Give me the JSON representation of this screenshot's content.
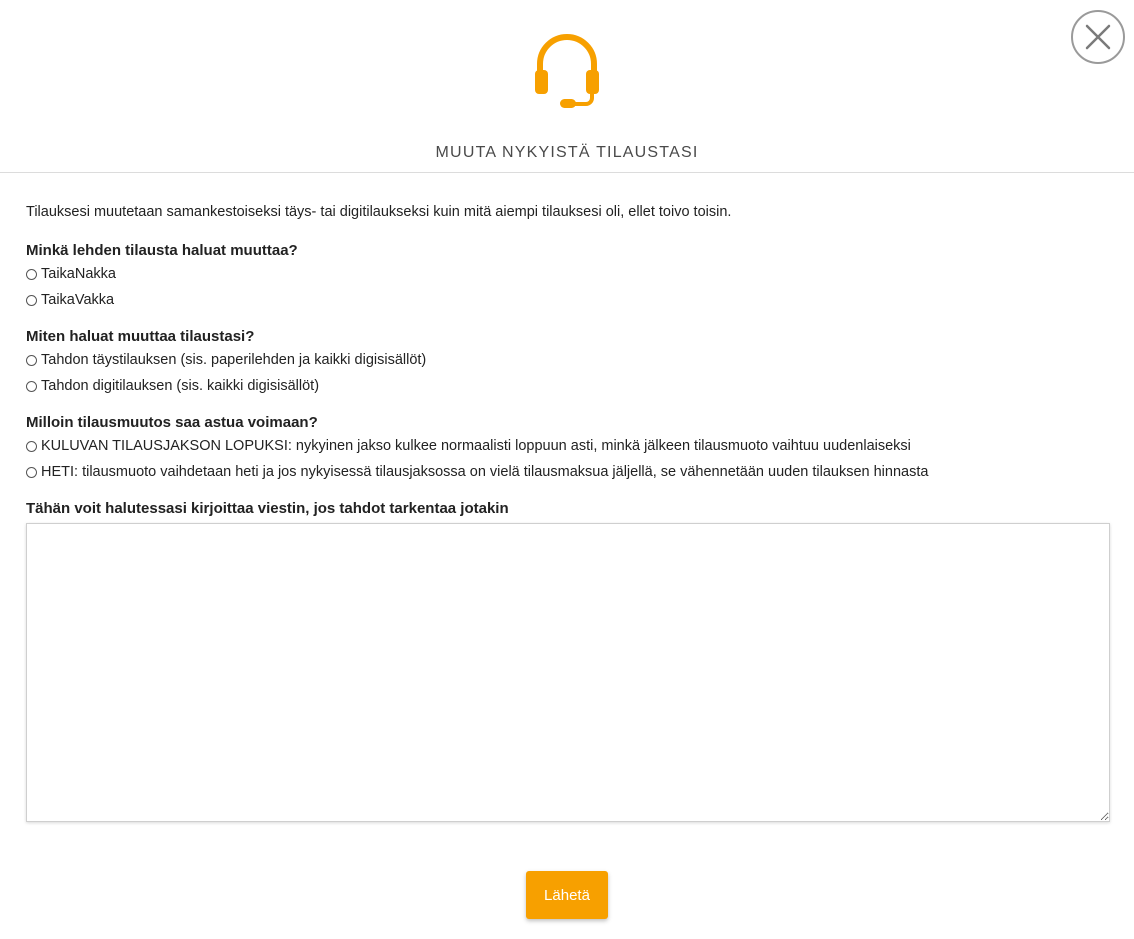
{
  "header": {
    "icon": "headset-icon",
    "title": "MUUTA NYKYISTÄ TILAUSTASI",
    "close_icon": "close-icon",
    "accent_color": "#f7a000"
  },
  "form": {
    "intro": "Tilauksesi muutetaan samankestoiseksi täys- tai digitilaukseksi kuin mitä aiempi tilauksesi oli, ellet toivo toisin.",
    "questions": [
      {
        "label": "Minkä lehden tilausta haluat muuttaa?",
        "options": [
          "TaikaNakka",
          "TaikaVakka"
        ]
      },
      {
        "label": "Miten haluat muuttaa tilaustasi?",
        "options": [
          "Tahdon täystilauksen (sis. paperilehden ja kaikki digisisällöt)",
          "Tahdon digitilauksen (sis. kaikki digisisällöt)"
        ]
      },
      {
        "label": "Milloin tilausmuutos saa astua voimaan?",
        "options": [
          "KULUVAN TILAUSJAKSON LOPUKSI: nykyinen jakso kulkee normaalisti loppuun asti, minkä jälkeen tilausmuoto vaihtuu uudenlaiseksi",
          "HETI: tilausmuoto vaihdetaan heti ja jos nykyisessä tilausjaksossa on vielä tilausmaksua jäljellä, se vähennetään uuden tilauksen hinnasta"
        ]
      }
    ],
    "message_label": "Tähän voit halutessasi kirjoittaa viestin, jos tahdot tarkentaa jotakin",
    "message_value": "",
    "submit_label": "Lähetä"
  }
}
